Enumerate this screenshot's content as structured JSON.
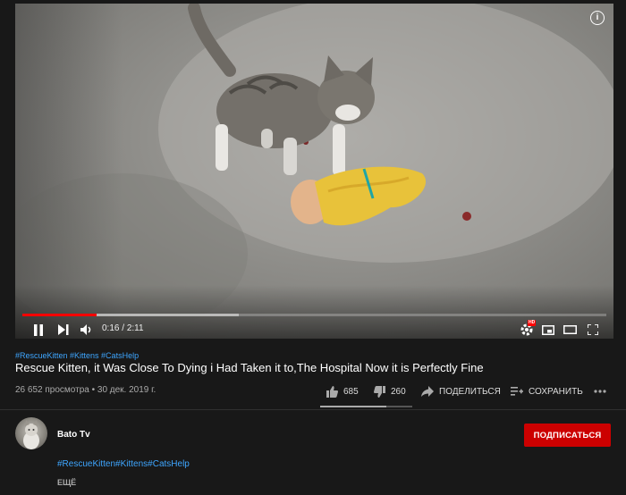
{
  "player": {
    "time_current": "0:16",
    "time_separator": "/",
    "time_total": "2:11",
    "progress_played": 0.127,
    "progress_buffered": 0.37,
    "info_label": "i",
    "hd_badge": "HD",
    "icons": [
      "info-icon",
      "play-pause-icon",
      "next-icon",
      "volume-icon",
      "settings-icon",
      "miniplayer-icon",
      "theater-icon",
      "fullscreen-icon"
    ]
  },
  "video": {
    "hashtags": "#RescueKitten #Kittens #CatsHelp",
    "title": "Rescue Kitten, it Was Close To Dying i Had Taken it to,The Hospital Now it is Perfectly Fine",
    "views_date": "26 652 просмотра • 30 дек. 2019 г.",
    "likes": "685",
    "dislikes": "260",
    "like_ratio": 0.72,
    "share_label": "ПОДЕЛИТЬСЯ",
    "save_label": "СОХРАНИТЬ"
  },
  "channel": {
    "name": "Bato Tv",
    "subscribe_label": "ПОДПИСАТЬСЯ"
  },
  "description": {
    "tags": "#RescueKitten#Kittens#CatsHelp",
    "more_label": "ЕЩЁ"
  },
  "colors": {
    "accent_red": "#ff0000",
    "subscribe_bg": "#cc0000",
    "link_blue": "#3ea6ff",
    "background": "#181818"
  }
}
